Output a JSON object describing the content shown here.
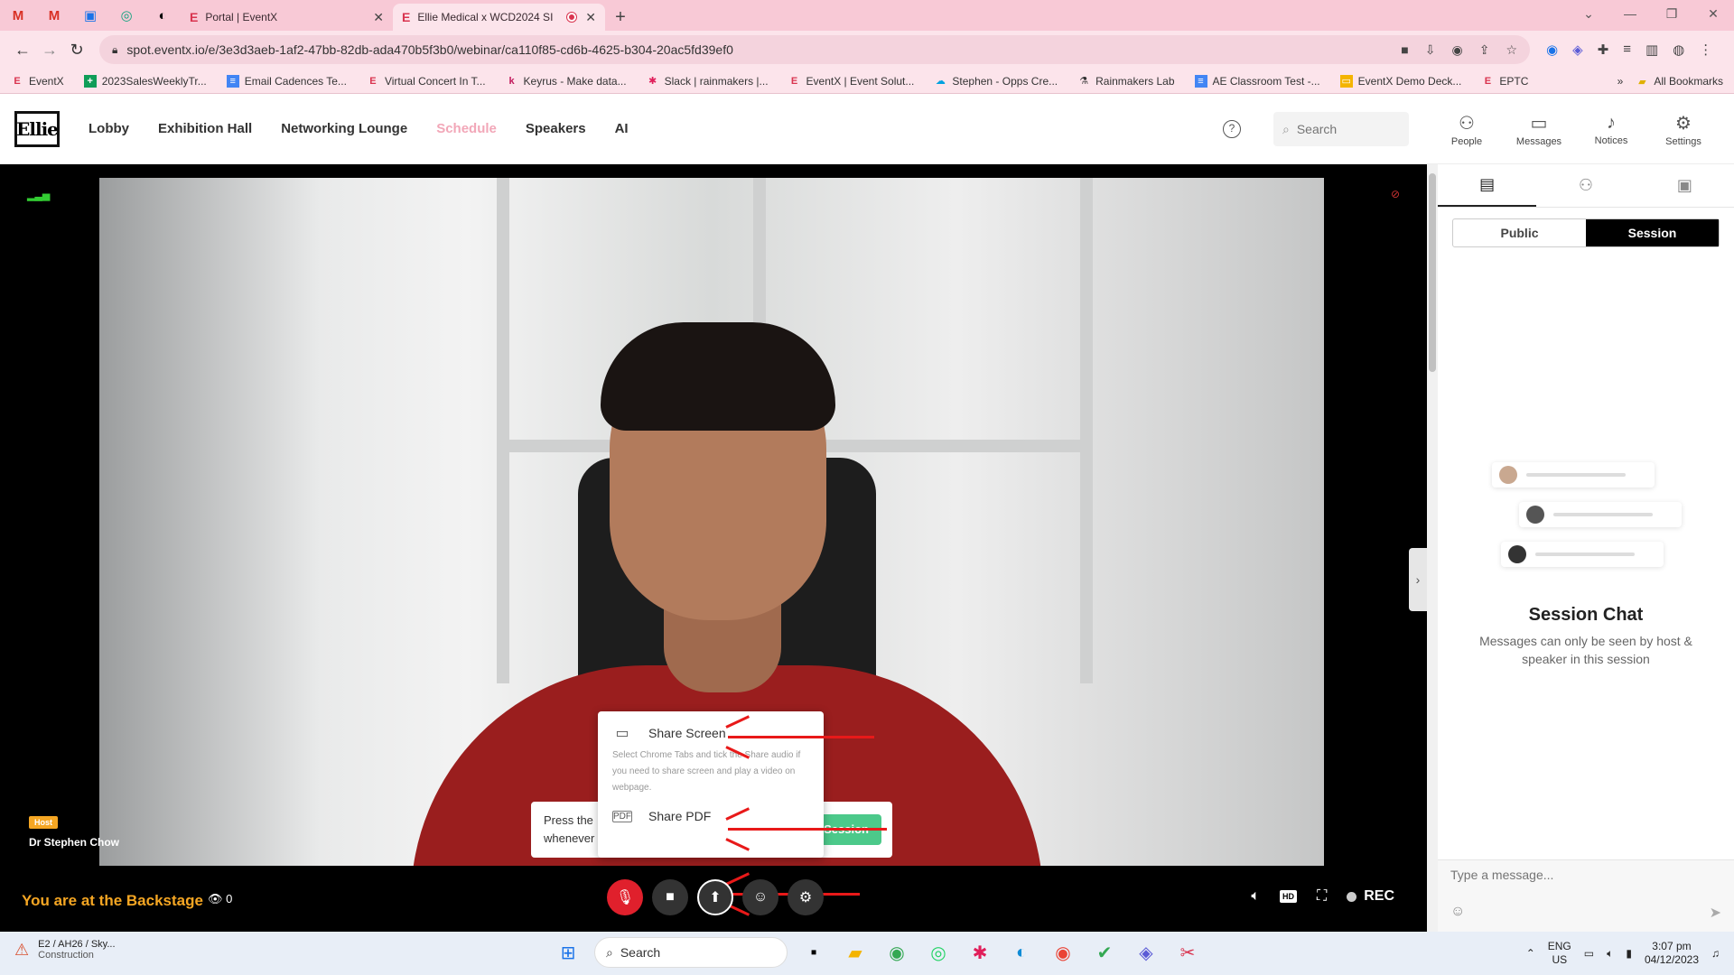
{
  "browser": {
    "tabs": [
      {
        "title": "Portal | EventX",
        "active": false
      },
      {
        "title": "Ellie Medical x WCD2024 SI",
        "active": true
      }
    ],
    "url": "spot.eventx.io/e/3e3d3aeb-1af2-47bb-82db-ada470b5f3b0/webinar/ca110f85-cd6b-4625-b304-20ac5fd39ef0",
    "bookmarks": [
      "EventX",
      "2023SalesWeeklyTr...",
      "Email Cadences Te...",
      "Virtual Concert In T...",
      "Keyrus - Make data...",
      "Slack | rainmakers |...",
      "EventX | Event Solut...",
      "Stephen - Opps Cre...",
      "Rainmakers Lab",
      "AE Classroom Test -...",
      "EventX Demo Deck...",
      "EPTC"
    ],
    "all_bookmarks": "All Bookmarks"
  },
  "app": {
    "logo": "Ellie",
    "nav": [
      "Lobby",
      "Exhibition Hall",
      "Networking Lounge",
      "Schedule",
      "Speakers",
      "AI"
    ],
    "search_placeholder": "Search",
    "header_buttons": [
      "People",
      "Messages",
      "Notices",
      "Settings"
    ]
  },
  "stage": {
    "host_tag": "Host",
    "host_name": "Dr Stephen Chow",
    "backstage_text": "You are at the Backstage",
    "viewer_count": "0",
    "toast_text": "Press the whenever",
    "toast_button": "Session",
    "share_menu": {
      "share_screen": "Share Screen",
      "hint": "Select Chrome Tabs and tick the Share audio if you need to share screen and play a video on webpage.",
      "share_pdf": "Share PDF"
    },
    "hd": "HD",
    "rec": "REC"
  },
  "side_panel": {
    "segments": [
      "Public",
      "Session"
    ],
    "chat_title": "Session Chat",
    "chat_desc": "Messages can only be seen by host & speaker in this session",
    "message_placeholder": "Type a message..."
  },
  "taskbar": {
    "weather_title": "E2 / AH26 / Sky...",
    "weather_sub": "Construction",
    "search": "Search",
    "lang": "ENG",
    "region": "US",
    "time": "3:07 pm",
    "date": "04/12/2023"
  },
  "colors": {
    "accent": "#f2a7b8",
    "backstage": "#f5a623",
    "annotation_arrow": "#e81919",
    "mic_off": "#e0202c"
  }
}
